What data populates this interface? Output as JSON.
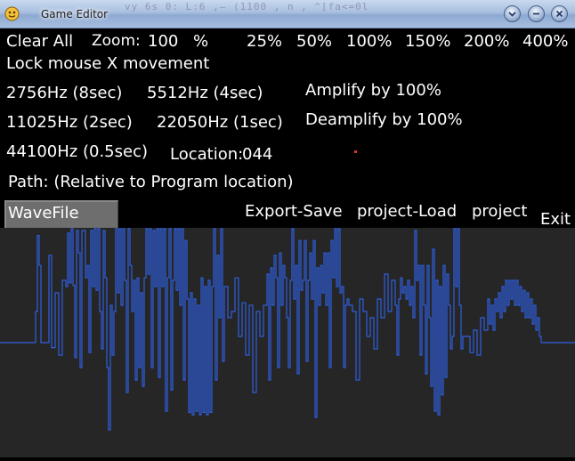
{
  "window": {
    "title": "Game Editor",
    "background_text": "vy 6s 0:   L:6 ,— (1100   , n   ,   ^[fa<=0l"
  },
  "toolbar": {
    "clear_all": "Clear   All",
    "zoom_label": "Zoom:",
    "zoom_value": "100",
    "zoom_unit": "%",
    "zoom_presets": [
      "25%",
      "50%",
      "100%",
      "150%",
      "200%",
      "400%"
    ],
    "lock_mouse": "Lock   mouse   X   movement"
  },
  "sample_rates": [
    "2756Hz  (8sec)",
    "5512Hz  (4sec)",
    "11025Hz  (2sec)",
    "22050Hz  (1sec)",
    "44100Hz  (0.5sec)"
  ],
  "amplify": "Amplify   by   100%",
  "deamplify": "Deamplify   by   100%",
  "location": {
    "label": "Location:",
    "value": "044"
  },
  "path_label": "Path:   (Relative   to   Program   location)",
  "wavefile_input": {
    "value": "WaveFile"
  },
  "actions": {
    "export": "Export-Save",
    "project_load": "project-Load",
    "project": "project",
    "exit": "Exit"
  },
  "waveform": {
    "color": "#2f5fe0",
    "background": "#262626",
    "samples": [
      [
        0,
        0
      ],
      [
        4,
        0
      ],
      [
        8,
        0
      ],
      [
        12,
        0
      ],
      [
        16,
        0
      ],
      [
        20,
        0
      ],
      [
        24,
        0
      ],
      [
        28,
        0
      ],
      [
        32,
        0
      ],
      [
        36,
        0
      ],
      [
        38,
        0
      ],
      [
        40,
        0.25
      ],
      [
        42,
        0.86
      ],
      [
        44,
        0.62
      ],
      [
        46,
        0
      ],
      [
        50,
        0
      ],
      [
        55,
        0.7
      ],
      [
        58,
        -0.04
      ],
      [
        62,
        0.4
      ],
      [
        66,
        -0.1
      ],
      [
        70,
        0.5
      ],
      [
        74,
        0.45
      ],
      [
        76,
        0.88
      ],
      [
        78,
        0.48
      ],
      [
        80,
        0.92
      ],
      [
        82,
        0.46
      ],
      [
        84,
        -0.12
      ],
      [
        86,
        0.9
      ],
      [
        88,
        0.72
      ],
      [
        90,
        -0.2
      ],
      [
        92,
        0.9
      ],
      [
        94,
        0.9
      ],
      [
        96,
        0.52
      ],
      [
        98,
        0.62
      ],
      [
        100,
        -0.08
      ],
      [
        102,
        0.9
      ],
      [
        104,
        0.45
      ],
      [
        106,
        0.92
      ],
      [
        108,
        0.42
      ],
      [
        110,
        0.92
      ],
      [
        112,
        0.25
      ],
      [
        114,
        -0.05
      ],
      [
        116,
        0.9
      ],
      [
        118,
        0.52
      ],
      [
        120,
        -0.2
      ],
      [
        122,
        -0.7
      ],
      [
        124,
        0.3
      ],
      [
        126,
        -0.1
      ],
      [
        128,
        0.25
      ],
      [
        130,
        0.92
      ],
      [
        132,
        0.4
      ],
      [
        134,
        0.92
      ],
      [
        136,
        0.3
      ],
      [
        138,
        0.92
      ],
      [
        140,
        0.5
      ],
      [
        142,
        -0.4
      ],
      [
        144,
        0.92
      ],
      [
        146,
        0.62
      ],
      [
        148,
        0.25
      ],
      [
        150,
        0.5
      ],
      [
        152,
        -0.3
      ],
      [
        154,
        0.52
      ],
      [
        156,
        -0.2
      ],
      [
        158,
        0.4
      ],
      [
        160,
        -0.35
      ],
      [
        162,
        0.52
      ],
      [
        164,
        0.92
      ],
      [
        166,
        0.55
      ],
      [
        168,
        0.92
      ],
      [
        170,
        -0.2
      ],
      [
        172,
        0.9
      ],
      [
        174,
        0.45
      ],
      [
        176,
        0.92
      ],
      [
        178,
        -0.28
      ],
      [
        180,
        0.92
      ],
      [
        182,
        0.45
      ],
      [
        184,
        0.92
      ],
      [
        186,
        -0.55
      ],
      [
        188,
        0.52
      ],
      [
        190,
        0.92
      ],
      [
        192,
        -0.38
      ],
      [
        194,
        0.5
      ],
      [
        196,
        0.92
      ],
      [
        198,
        0.42
      ],
      [
        200,
        0.92
      ],
      [
        202,
        0.3
      ],
      [
        204,
        0.92
      ],
      [
        206,
        -0.3
      ],
      [
        208,
        0.82
      ],
      [
        210,
        0.35
      ],
      [
        212,
        -0.56
      ],
      [
        214,
        0.4
      ],
      [
        216,
        -0.58
      ],
      [
        218,
        0.35
      ],
      [
        220,
        -0.55
      ],
      [
        222,
        0.3
      ],
      [
        224,
        -0.58
      ],
      [
        226,
        0.52
      ],
      [
        228,
        -0.56
      ],
      [
        230,
        0.45
      ],
      [
        232,
        -0.58
      ],
      [
        234,
        0.5
      ],
      [
        236,
        -0.56
      ],
      [
        238,
        0.45
      ],
      [
        240,
        0.92
      ],
      [
        242,
        -0.3
      ],
      [
        244,
        0.7
      ],
      [
        246,
        0.2
      ],
      [
        248,
        0.92
      ],
      [
        250,
        -0.15
      ],
      [
        252,
        0.45
      ],
      [
        256,
        0.2
      ],
      [
        260,
        0.25
      ],
      [
        264,
        0.52
      ],
      [
        268,
        0.05
      ],
      [
        272,
        0.32
      ],
      [
        276,
        -0.1
      ],
      [
        280,
        0.3
      ],
      [
        284,
        -0.4
      ],
      [
        288,
        0.25
      ],
      [
        292,
        0.05
      ],
      [
        296,
        0.3
      ],
      [
        300,
        0.55
      ],
      [
        302,
        -0.3
      ],
      [
        304,
        0.6
      ],
      [
        306,
        0.3
      ],
      [
        308,
        0.7
      ],
      [
        310,
        0.52
      ],
      [
        312,
        -0.2
      ],
      [
        314,
        0.72
      ],
      [
        316,
        0.3
      ],
      [
        318,
        0.62
      ],
      [
        320,
        0.52
      ],
      [
        322,
        0.2
      ],
      [
        324,
        -0.2
      ],
      [
        326,
        0.5
      ],
      [
        328,
        0.92
      ],
      [
        330,
        0.35
      ],
      [
        332,
        0.62
      ],
      [
        334,
        -0.25
      ],
      [
        336,
        0.82
      ],
      [
        338,
        0.42
      ],
      [
        340,
        0.5
      ],
      [
        342,
        0.82
      ],
      [
        344,
        -0.15
      ],
      [
        346,
        0.5
      ],
      [
        348,
        0.72
      ],
      [
        350,
        0.35
      ],
      [
        352,
        0.82
      ],
      [
        354,
        -0.6
      ],
      [
        356,
        0.6
      ],
      [
        358,
        0.3
      ],
      [
        360,
        0.62
      ],
      [
        362,
        0.4
      ],
      [
        364,
        0.72
      ],
      [
        366,
        0.3
      ],
      [
        368,
        0.72
      ],
      [
        370,
        -0.2
      ],
      [
        372,
        0.82
      ],
      [
        374,
        0.52
      ],
      [
        376,
        0.92
      ],
      [
        378,
        0.45
      ],
      [
        380,
        0.92
      ],
      [
        382,
        0.4
      ],
      [
        384,
        0.45
      ],
      [
        386,
        -0.2
      ],
      [
        388,
        0.3
      ],
      [
        390,
        0.35
      ],
      [
        392,
        0.3
      ],
      [
        396,
        0.25
      ],
      [
        400,
        -0.3
      ],
      [
        404,
        0.35
      ],
      [
        408,
        0.25
      ],
      [
        412,
        0.05
      ],
      [
        416,
        0.2
      ],
      [
        420,
        -0.05
      ],
      [
        424,
        0.35
      ],
      [
        428,
        0.2
      ],
      [
        432,
        0.55
      ],
      [
        436,
        0.25
      ],
      [
        440,
        0.5
      ],
      [
        444,
        0.3
      ],
      [
        446,
        -0.1
      ],
      [
        448,
        0.35
      ],
      [
        450,
        0.52
      ],
      [
        452,
        0.4
      ],
      [
        454,
        0.45
      ],
      [
        456,
        0.35
      ],
      [
        458,
        0.5
      ],
      [
        460,
        0.3
      ],
      [
        462,
        0.45
      ],
      [
        464,
        0.2
      ],
      [
        466,
        0.9
      ],
      [
        468,
        0.5
      ],
      [
        470,
        0.62
      ],
      [
        472,
        -0.1
      ],
      [
        474,
        0.62
      ],
      [
        476,
        0.3
      ],
      [
        478,
        -0.25
      ],
      [
        480,
        0.62
      ],
      [
        482,
        0.2
      ],
      [
        484,
        -0.35
      ],
      [
        486,
        0.75
      ],
      [
        488,
        -0.55
      ],
      [
        490,
        0.5
      ],
      [
        492,
        -0.58
      ],
      [
        494,
        0.45
      ],
      [
        496,
        -0.42
      ],
      [
        498,
        0.62
      ],
      [
        500,
        -0.28
      ],
      [
        502,
        0.55
      ],
      [
        504,
        0.3
      ],
      [
        506,
        -0.05
      ],
      [
        508,
        0.05
      ],
      [
        510,
        0.92
      ],
      [
        512,
        0.45
      ],
      [
        514,
        0.92
      ],
      [
        516,
        0.3
      ],
      [
        518,
        -0.05
      ],
      [
        520,
        0.05
      ],
      [
        524,
        0.05
      ],
      [
        528,
        -0.08
      ],
      [
        532,
        0.1
      ],
      [
        536,
        -0.1
      ],
      [
        540,
        0.2
      ],
      [
        544,
        0.1
      ],
      [
        548,
        0.35
      ],
      [
        550,
        0.15
      ],
      [
        552,
        0.3
      ],
      [
        554,
        0.1
      ],
      [
        556,
        0.35
      ],
      [
        558,
        0.25
      ],
      [
        560,
        0.4
      ],
      [
        562,
        0.2
      ],
      [
        564,
        0.45
      ],
      [
        566,
        0.25
      ],
      [
        568,
        0.5
      ],
      [
        570,
        0.3
      ],
      [
        572,
        0.5
      ],
      [
        574,
        0.35
      ],
      [
        576,
        0.5
      ],
      [
        578,
        0.3
      ],
      [
        580,
        0.5
      ],
      [
        582,
        0.3
      ],
      [
        584,
        0.45
      ],
      [
        586,
        0.25
      ],
      [
        588,
        0.42
      ],
      [
        590,
        0.2
      ],
      [
        592,
        0.4
      ],
      [
        594,
        0.2
      ],
      [
        596,
        0.35
      ],
      [
        598,
        0.15
      ],
      [
        600,
        0.3
      ],
      [
        602,
        0.1
      ],
      [
        604,
        0.2
      ],
      [
        606,
        0.05
      ],
      [
        608,
        0
      ],
      [
        612,
        0
      ],
      [
        620,
        0
      ],
      [
        630,
        0
      ],
      [
        640,
        0
      ],
      [
        646,
        0
      ]
    ]
  }
}
